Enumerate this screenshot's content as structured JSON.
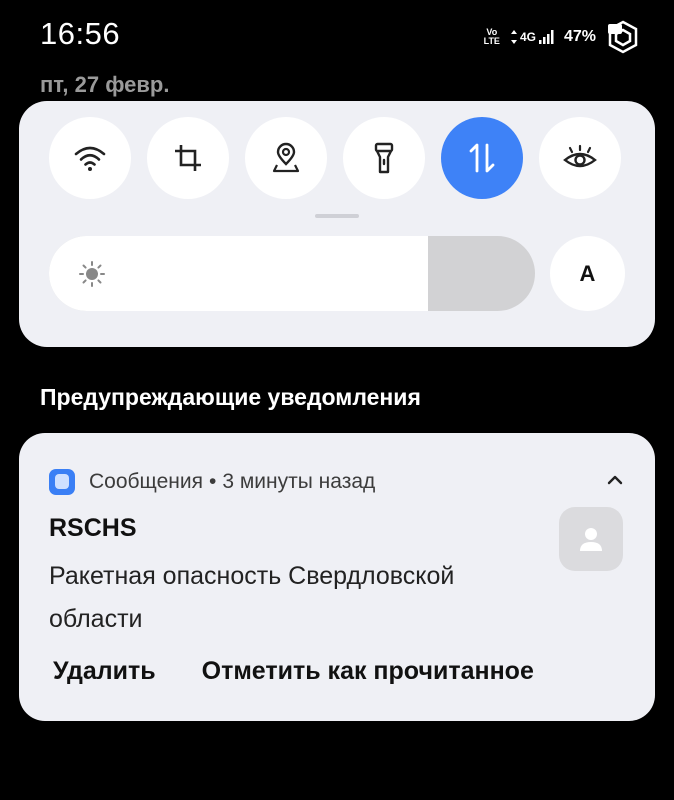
{
  "status_bar": {
    "time": "16:56",
    "volte_top": "Vo",
    "volte_bottom": "LTE",
    "network": "4G",
    "battery": "47%"
  },
  "date": "пт, 27 февр.",
  "quick_settings": {
    "tiles": [
      {
        "name": "wifi",
        "icon": "wifi-icon",
        "active": false
      },
      {
        "name": "crop",
        "icon": "crop-icon",
        "active": false
      },
      {
        "name": "location",
        "icon": "location-icon",
        "active": false
      },
      {
        "name": "flashlight",
        "icon": "flashlight-icon",
        "active": false
      },
      {
        "name": "mobile-data",
        "icon": "data-transfer-icon",
        "active": true
      },
      {
        "name": "eye-comfort",
        "icon": "eye-icon",
        "active": false
      }
    ],
    "brightness_level": 0.78,
    "auto_brightness_label": "A"
  },
  "section_title": "Предупреждающие уведомления",
  "notification": {
    "app_name": "Сообщения",
    "separator": "•",
    "time_ago": "3 минуты назад",
    "title": "RSCHS",
    "body": "Ракетная опасность Свердловской области",
    "actions": {
      "delete": "Удалить",
      "mark_read": "Отметить как прочитанное"
    }
  },
  "colors": {
    "background": "#000000",
    "panel": "#eff0f5",
    "accent": "#3e82f7",
    "app_icon": "#3a7ff5"
  }
}
